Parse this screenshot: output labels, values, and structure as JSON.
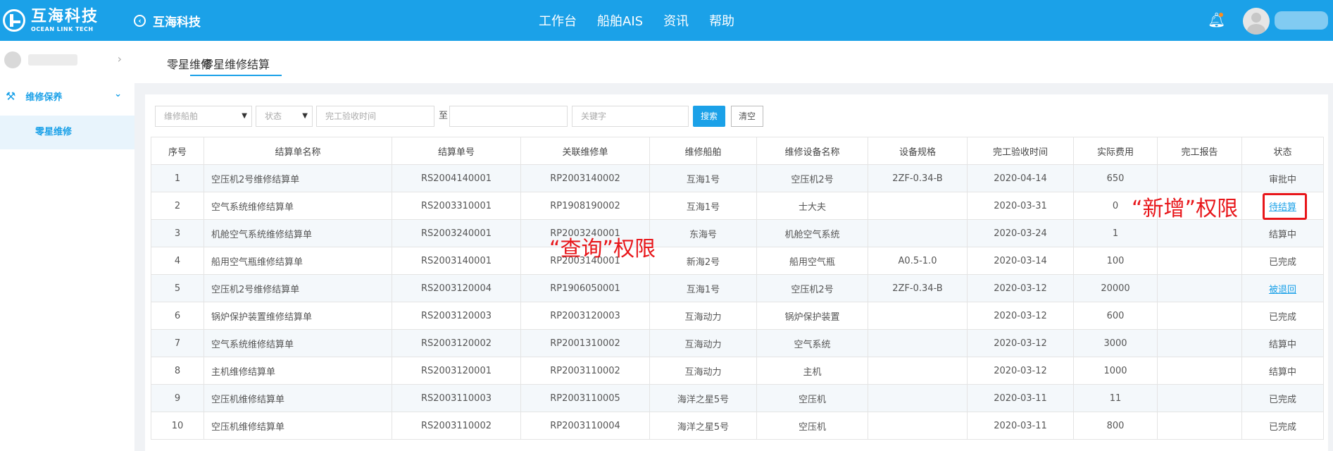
{
  "brand": {
    "name_cn": "互海科技",
    "name_en": "OCEAN LINK TECH"
  },
  "header": {
    "back_label": "互海科技",
    "nav": [
      "工作台",
      "船舶AIS",
      "资讯",
      "帮助"
    ]
  },
  "sidebar": {
    "menu_label": "维修保养",
    "sub_label": "零星维修"
  },
  "tabs": [
    "零星维修",
    "零星维修结算"
  ],
  "filters": {
    "ship_placeholder": "维修船舶",
    "status_placeholder": "状态",
    "date_from_placeholder": "完工验收时间",
    "to_label": "至",
    "keyword_placeholder": "关键字",
    "search_label": "搜索",
    "clear_label": "清空"
  },
  "table": {
    "headers": [
      "序号",
      "结算单名称",
      "结算单号",
      "关联维修单",
      "维修船舶",
      "维修设备名称",
      "设备规格",
      "完工验收时间",
      "实际费用",
      "完工报告",
      "状态"
    ],
    "rows": [
      [
        "1",
        "空压机2号维修结算单",
        "RS2004140001",
        "RP2003140002",
        "互海1号",
        "空压机2号",
        "2ZF-0.34-B",
        "2020-04-14",
        "650",
        "",
        "审批中"
      ],
      [
        "2",
        "空气系统维修结算单",
        "RS2003310001",
        "RP1908190002",
        "互海1号",
        "士大夫",
        "",
        "2020-03-31",
        "0",
        "",
        "待结算"
      ],
      [
        "3",
        "机舱空气系统维修结算单",
        "RS2003240001",
        "RP2003240001",
        "东海号",
        "机舱空气系统",
        "",
        "2020-03-24",
        "1",
        "",
        "结算中"
      ],
      [
        "4",
        "船用空气瓶维修结算单",
        "RS2003140001",
        "RP2003140001",
        "新海2号",
        "船用空气瓶",
        "A0.5-1.0",
        "2020-03-14",
        "100",
        "",
        "已完成"
      ],
      [
        "5",
        "空压机2号维修结算单",
        "RS2003120004",
        "RP1906050001",
        "互海1号",
        "空压机2号",
        "2ZF-0.34-B",
        "2020-03-12",
        "20000",
        "",
        "被退回"
      ],
      [
        "6",
        "锅炉保护装置维修结算单",
        "RS2003120003",
        "RP2003120003",
        "互海动力",
        "锅炉保护装置",
        "",
        "2020-03-12",
        "600",
        "",
        "已完成"
      ],
      [
        "7",
        "空气系统维修结算单",
        "RS2003120002",
        "RP2001310002",
        "互海动力",
        "空气系统",
        "",
        "2020-03-12",
        "3000",
        "",
        "结算中"
      ],
      [
        "8",
        "主机维修结算单",
        "RS2003120001",
        "RP2003110002",
        "互海动力",
        "主机",
        "",
        "2020-03-12",
        "1000",
        "",
        "结算中"
      ],
      [
        "9",
        "空压机维修结算单",
        "RS2003110003",
        "RP2003110005",
        "海洋之星5号",
        "空压机",
        "",
        "2020-03-11",
        "11",
        "",
        "已完成"
      ],
      [
        "10",
        "空压机维修结算单",
        "RS2003110002",
        "RP2003110004",
        "海洋之星5号",
        "空压机",
        "",
        "2020-03-11",
        "800",
        "",
        "已完成"
      ]
    ],
    "link_statuses": [
      "待结算",
      "被退回"
    ]
  },
  "annotations": {
    "query": "“查询”权限",
    "add": "“新增”权限"
  },
  "colors": {
    "primary": "#1ba1e8",
    "annotation": "#e8161a"
  },
  "icons": {
    "back": "back-circle-icon",
    "bell": "bell-icon",
    "wrench": "wrench-icon"
  }
}
